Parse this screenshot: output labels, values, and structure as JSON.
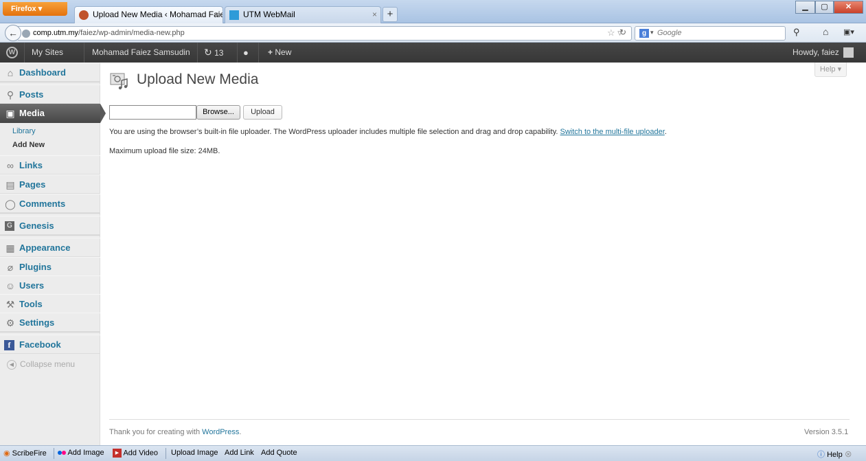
{
  "browser": {
    "menu_button": "Firefox",
    "tabs": [
      {
        "label": "Upload New Media ‹ Mohamad Faiez ...",
        "close": "×"
      },
      {
        "label": "UTM WebMail",
        "close": "×"
      }
    ],
    "new_tab": "+",
    "url_domain": "comp.utm.my",
    "url_path": "/faiez/wp-admin/media-new.php",
    "search_placeholder": "Google"
  },
  "adminbar": {
    "my_sites": "My Sites",
    "site_name": "Mohamad Faiez Samsudin",
    "updates_count": "13",
    "new_label": "New",
    "howdy": "Howdy, faiez"
  },
  "sidebar": {
    "items": [
      {
        "label": "Dashboard",
        "icon": "home-icon"
      },
      {
        "label": "Posts",
        "icon": "pin-icon"
      },
      {
        "label": "Media",
        "icon": "media-icon"
      },
      {
        "label": "Links",
        "icon": "link-icon"
      },
      {
        "label": "Pages",
        "icon": "pages-icon"
      },
      {
        "label": "Comments",
        "icon": "comment-icon"
      },
      {
        "label": "Genesis",
        "icon": "genesis-icon"
      },
      {
        "label": "Appearance",
        "icon": "appearance-icon"
      },
      {
        "label": "Plugins",
        "icon": "plugin-icon"
      },
      {
        "label": "Users",
        "icon": "users-icon"
      },
      {
        "label": "Tools",
        "icon": "tools-icon"
      },
      {
        "label": "Settings",
        "icon": "settings-icon"
      },
      {
        "label": "Facebook",
        "icon": "facebook-icon"
      }
    ],
    "submenu": [
      {
        "label": "Library"
      },
      {
        "label": "Add New"
      }
    ],
    "collapse": "Collapse menu"
  },
  "main": {
    "help": "Help",
    "title": "Upload New Media",
    "browse": "Browse...",
    "upload": "Upload",
    "note": "You are using the browser’s built-in file uploader. The WordPress uploader includes multiple file selection and drag and drop capability.",
    "note_link": "Switch to the multi-file uploader",
    "max_size": "Maximum upload file size: 24MB.",
    "footer_thanks": "Thank you for creating with",
    "footer_link": "WordPress",
    "version": "Version 3.5.1"
  },
  "addonbar": {
    "scribefire": "ScribeFire",
    "add_image": "Add Image",
    "add_video": "Add Video",
    "upload_image": "Upload Image",
    "add_link": "Add Link",
    "add_quote": "Add Quote",
    "help": "Help"
  },
  "colors": {
    "link": "#21759b",
    "adminbar": "#464646",
    "sidebar": "#ececec"
  }
}
